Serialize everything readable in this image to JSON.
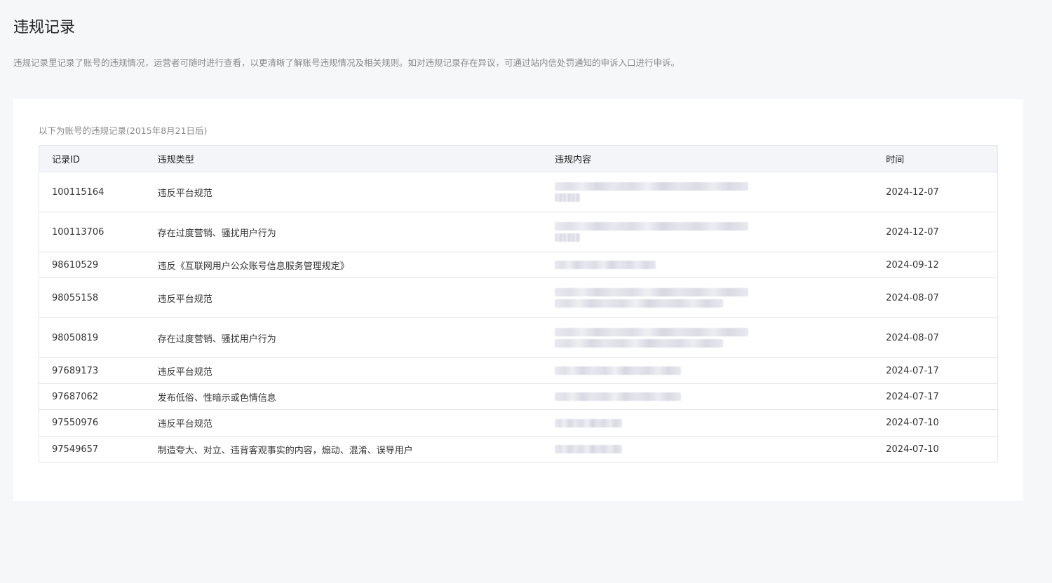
{
  "page": {
    "title": "违规记录",
    "description": "违规记录里记录了账号的违规情况，运营者可随时进行查看，以更清晰了解账号违规情况及相关规则。如对违规记录存在异议，可通过站内信处罚通知的申诉入口进行申诉。"
  },
  "card": {
    "subtitle": "以下为账号的违规记录(2015年8月21日后)"
  },
  "table": {
    "headers": {
      "id": "记录ID",
      "type": "违规类型",
      "content": "违规内容",
      "time": "时间"
    },
    "rows": [
      {
        "id": "100115164",
        "type": "违反平台规范",
        "time": "2024-12-07"
      },
      {
        "id": "100113706",
        "type": "存在过度营销、骚扰用户行为",
        "time": "2024-12-07"
      },
      {
        "id": "98610529",
        "type": "违反《互联网用户公众账号信息服务管理规定》",
        "time": "2024-09-12"
      },
      {
        "id": "98055158",
        "type": "违反平台规范",
        "time": "2024-08-07"
      },
      {
        "id": "98050819",
        "type": "存在过度营销、骚扰用户行为",
        "time": "2024-08-07"
      },
      {
        "id": "97689173",
        "type": "违反平台规范",
        "time": "2024-07-17"
      },
      {
        "id": "97687062",
        "type": "发布低俗、性暗示或色情信息",
        "time": "2024-07-17"
      },
      {
        "id": "97550976",
        "type": "违反平台规范",
        "time": "2024-07-10"
      },
      {
        "id": "97549657",
        "type": "制造夸大、对立、违背客观事实的内容，煽动、混淆、误导用户",
        "time": "2024-07-10"
      }
    ]
  }
}
